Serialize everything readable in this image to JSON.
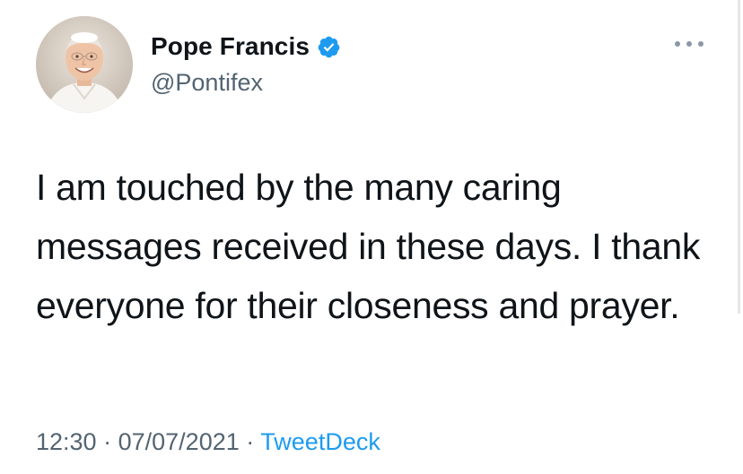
{
  "user": {
    "display_name": "Pope Francis",
    "handle": "@Pontifex",
    "verified": true,
    "verified_color": "#1d9bf0"
  },
  "icons": {
    "verified": "verified-badge-icon",
    "more": "more-options-icon"
  },
  "tweet": {
    "text": "I am touched by the many caring messages received in these days. I thank everyone for their closeness and prayer.",
    "time": "12:30",
    "date": "07/07/2021",
    "separator": "·",
    "source": "TweetDeck"
  },
  "colors": {
    "text": "#0f1419",
    "muted": "#536471",
    "link": "#1d9bf0"
  }
}
